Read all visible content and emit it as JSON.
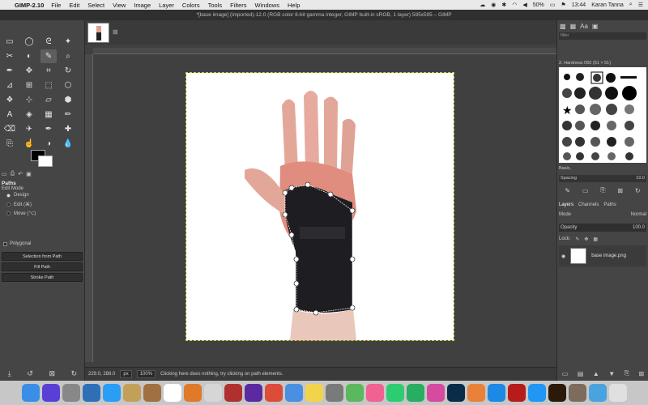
{
  "menubar": {
    "app_name": "GIMP-2.10",
    "menus": [
      "File",
      "Edit",
      "Select",
      "View",
      "Image",
      "Layer",
      "Colors",
      "Tools",
      "Filters",
      "Windows",
      "Help"
    ],
    "battery": "50%",
    "time": "13:44",
    "user": "Karan Tanna"
  },
  "window": {
    "title": "*[base image] (imported)-12.0 (RGB color 8-bit gamma integer, GIMP built-in sRGB, 1 layer) 595x595 – GIMP"
  },
  "tool_options": {
    "section_title": "Paths",
    "edit_mode_label": "Edit Mode",
    "modes": [
      "Design",
      "Edit (⌘)",
      "Move (⌥)"
    ],
    "selected_mode": 0,
    "polygonal_label": "Polygonal",
    "buttons": [
      "Selection from Path",
      "Fill Path",
      "Stroke Path"
    ]
  },
  "statusbar": {
    "coords": "229.0, 288.0",
    "unit": "px",
    "zoom": "100%",
    "message": "Clicking here does nothing, try clicking on path elements."
  },
  "brushes": {
    "filter_placeholder": "filter",
    "current_brush": "2. Hardness 050 (51 × 51)",
    "preset": "Basic,",
    "spacing_label": "Spacing",
    "spacing_value": "10.0"
  },
  "layers": {
    "tabs": [
      "Layers",
      "Channels",
      "Paths"
    ],
    "mode_label": "Mode",
    "mode_value": "Normal",
    "opacity_label": "Opacity",
    "opacity_value": "100.0",
    "lock_label": "Lock:",
    "items": [
      {
        "name": "base image.png"
      }
    ]
  },
  "dock_apps": [
    {
      "icon": "finder",
      "color": "#3a8ee6"
    },
    {
      "icon": "siri",
      "color": "#5a3fd6"
    },
    {
      "icon": "launchpad",
      "color": "#888888"
    },
    {
      "icon": "photos-preview",
      "color": "#2f6fb8"
    },
    {
      "icon": "safari",
      "color": "#2a9df4"
    },
    {
      "icon": "notes-app",
      "color": "#c2a05a"
    },
    {
      "icon": "notebook",
      "color": "#a07040"
    },
    {
      "icon": "calendar",
      "color": "#ffffff"
    },
    {
      "icon": "books",
      "color": "#e07a2a"
    },
    {
      "icon": "stickies",
      "color": "#d6d6d6"
    },
    {
      "icon": "cards",
      "color": "#b03030"
    },
    {
      "icon": "imovie",
      "color": "#5b2aa0"
    },
    {
      "icon": "chrome",
      "color": "#dd4b39"
    },
    {
      "icon": "document",
      "color": "#4a90e2"
    },
    {
      "icon": "notes",
      "color": "#f2d44a"
    },
    {
      "icon": "textedit",
      "color": "#7a7a7a"
    },
    {
      "icon": "maps",
      "color": "#5cb85c"
    },
    {
      "icon": "photos",
      "color": "#f06292"
    },
    {
      "icon": "messages",
      "color": "#2ecc71"
    },
    {
      "icon": "facetime",
      "color": "#27ae60"
    },
    {
      "icon": "itunes",
      "color": "#d64aa0"
    },
    {
      "icon": "photoshop",
      "color": "#0b2b4a"
    },
    {
      "icon": "ibooks",
      "color": "#e8823a"
    },
    {
      "icon": "app-store",
      "color": "#1e88e5"
    },
    {
      "icon": "acrobat",
      "color": "#b71c1c"
    },
    {
      "icon": "sync",
      "color": "#2196f3"
    },
    {
      "icon": "illustrator",
      "color": "#2b1a0a"
    },
    {
      "icon": "gimp",
      "color": "#7d6b5b"
    },
    {
      "icon": "folder",
      "color": "#4aa3df"
    },
    {
      "icon": "trash",
      "color": "#e0e0e0"
    }
  ],
  "colors": {
    "accent_path": "#ffffff"
  }
}
